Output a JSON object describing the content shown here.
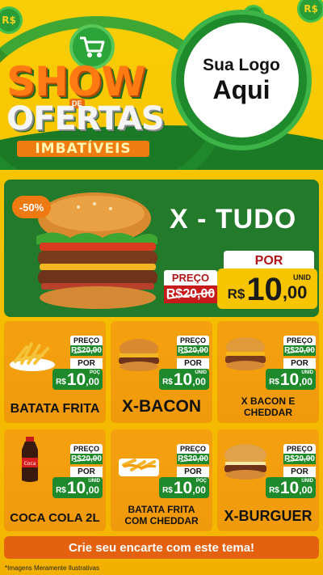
{
  "header": {
    "title_line1": "SHOW",
    "title_de": "DE",
    "title_line2": "OFERTAS",
    "title_line3": "IMBATÍVEIS",
    "coin_symbol": "R$",
    "logo_line1": "Sua Logo",
    "logo_line2": "Aqui"
  },
  "hero": {
    "discount": "-50%",
    "name": "X - TUDO",
    "preco_label": "PREÇO",
    "old_price": "R$20,00",
    "por_label": "POR",
    "currency": "R$",
    "price_int": "10",
    "price_dec": ",00",
    "unit": "UNID"
  },
  "products": [
    {
      "name": "BATATA FRITA",
      "preco_label": "PREÇO",
      "old_price": "R$20,00",
      "por_label": "POR",
      "currency": "R$",
      "price_int": "10",
      "price_dec": ",00",
      "unit": "POÇ"
    },
    {
      "name": "X-BACON",
      "preco_label": "PREÇO",
      "old_price": "R$20,00",
      "por_label": "POR",
      "currency": "R$",
      "price_int": "10",
      "price_dec": ",00",
      "unit": "UNID"
    },
    {
      "name": "X BACON E CHEDDAR",
      "preco_label": "PREÇO",
      "old_price": "R$20,00",
      "por_label": "POR",
      "currency": "R$",
      "price_int": "10",
      "price_dec": ",00",
      "unit": "UNID"
    },
    {
      "name": "COCA COLA 2L",
      "preco_label": "PREÇO",
      "old_price": "R$20,00",
      "por_label": "POR",
      "currency": "R$",
      "price_int": "10",
      "price_dec": ",00",
      "unit": "UNID"
    },
    {
      "name": "BATATA FRITA COM CHEDDAR",
      "preco_label": "PREÇO",
      "old_price": "R$20,00",
      "por_label": "POR",
      "currency": "R$",
      "price_int": "10",
      "price_dec": ",00",
      "unit": "POÇ"
    },
    {
      "name": "X-BURGUER",
      "preco_label": "PREÇO",
      "old_price": "R$20,00",
      "por_label": "POR",
      "currency": "R$",
      "price_int": "10",
      "price_dec": ",00",
      "unit": "UNID"
    }
  ],
  "cta": {
    "label": "Crie seu encarte com este tema!"
  },
  "footer": {
    "note": "*Imagens Meramente Ilustrativas"
  },
  "colors": {
    "green": "#1f8a2c",
    "orange": "#f07a12",
    "yellow": "#f7c400",
    "red": "#c71a1a"
  },
  "icons": [
    "shopping-cart-icon",
    "coin-icon"
  ]
}
